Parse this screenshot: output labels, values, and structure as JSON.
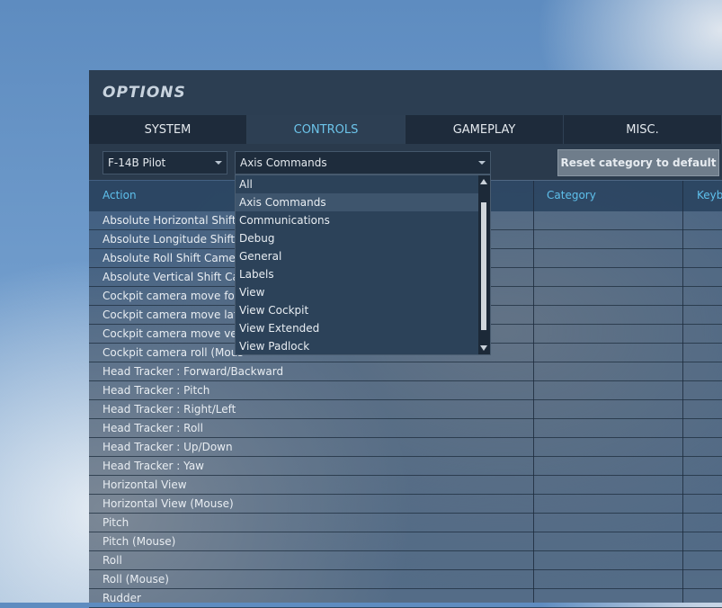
{
  "window": {
    "title": "OPTIONS"
  },
  "tabs": [
    "SYSTEM",
    "CONTROLS",
    "GAMEPLAY",
    "MISC."
  ],
  "toolbar": {
    "aircraft_select": "F-14B Pilot",
    "category_select": "Axis Commands",
    "reset_label": "Reset category to default"
  },
  "table": {
    "headers": {
      "action": "Action",
      "category": "Category",
      "keyboard": "Keyb"
    },
    "rows": [
      "Absolute Horizontal Shift",
      "Absolute Longitude Shift C",
      "Absolute Roll Shift Camer",
      "Absolute Vertical Shift Ca",
      "Cockpit camera move forv",
      "Cockpit camera move late",
      "Cockpit camera move ver",
      "Cockpit camera roll (Mous",
      "Head Tracker : Forward/Backward",
      "Head Tracker : Pitch",
      "Head Tracker : Right/Left",
      "Head Tracker : Roll",
      "Head Tracker : Up/Down",
      "Head Tracker : Yaw",
      "Horizontal View",
      "Horizontal View (Mouse)",
      "Pitch",
      "Pitch (Mouse)",
      "Roll",
      "Roll (Mouse)",
      "Rudder"
    ]
  },
  "dropdown": {
    "options": [
      "All",
      "Axis Commands",
      "Communications",
      "Debug",
      "General",
      "Labels",
      "View",
      "View Cockpit",
      "View Extended",
      "View Padlock"
    ],
    "selected": "Axis Commands"
  },
  "colors": {
    "accent": "#5ec0ec",
    "panel": "#2c3e52"
  }
}
